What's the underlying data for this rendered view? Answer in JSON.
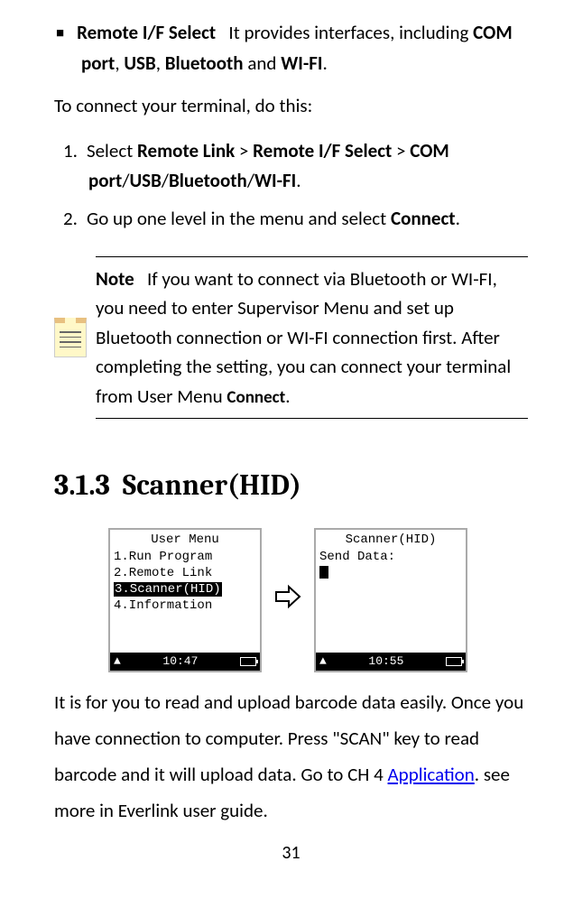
{
  "bullet": {
    "title": "Remote I/F Select",
    "rest_before": "It provides interfaces, including ",
    "b1": "COM port",
    "b2": "USB",
    "b3": "Bluetooth",
    "b4": "WI-FI",
    "period": "."
  },
  "intro": "To connect your terminal, do this:",
  "step1": {
    "num": "1.",
    "t1": "Select ",
    "b1": "Remote Link",
    "g1": " > ",
    "b2": "Remote I/F Select",
    "g2": " > ",
    "b3": "COM port",
    "s1": "/",
    "b4": "USB",
    "s2": "/",
    "b5": "Bluetooth",
    "s3": "/",
    "b6": "WI-FI",
    "end": "."
  },
  "step2": {
    "num": "2.",
    "t1": "Go up one level in the menu and select ",
    "b1": "Connect",
    "end": "."
  },
  "note": {
    "label": "Note",
    "body_before": "If you want to connect via Bluetooth or WI-FI, you need to enter Supervisor Menu and set up Bluetooth connection or WI-FI connection first. After completing the setting, you can connect your terminal from User Menu ",
    "connect": "Connect",
    "body_after": "."
  },
  "section": {
    "num": "3.1.3",
    "title": "Scanner(HID)"
  },
  "screen1": {
    "title": "User Menu",
    "l1": "1.Run Program",
    "l2": "2.Remote Link",
    "l3": "3.Scanner(HID)",
    "l4": "4.Information",
    "time": "10:47"
  },
  "screen2": {
    "title": "Scanner(HID)",
    "l1": "Send Data:",
    "time": "10:55"
  },
  "desc": {
    "t1": "It is for you to read and upload barcode data easily. Once you have connection to computer. Press \"SCAN\" key to read barcode and it will upload data. Go to CH 4 ",
    "link": "Application",
    "t2": ". see more in Everlink user guide."
  },
  "page": "31"
}
